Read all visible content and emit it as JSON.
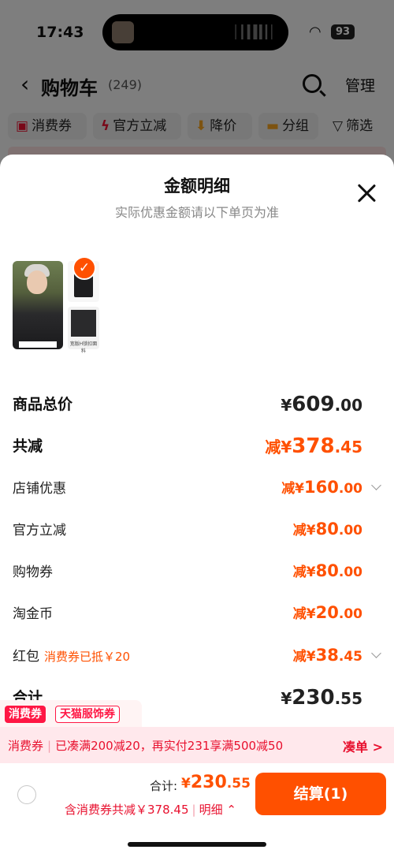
{
  "status": {
    "time": "17:43",
    "battery": "93"
  },
  "background": {
    "title": "购物车",
    "count": "(249)",
    "manage": "管理",
    "chips": [
      "消费券",
      "官方立减",
      "降价",
      "分组",
      "筛选"
    ]
  },
  "sheet": {
    "title": "金额明细",
    "subtitle": "实际优惠金额请以下单页为准",
    "product_caption": "宽版H锁扣面料"
  },
  "rows": [
    {
      "label": "商品总价",
      "prefix": "¥",
      "int": "609",
      "dec": ".00"
    },
    {
      "label": "共减",
      "prefix": "减¥",
      "int": "378",
      "dec": ".45"
    },
    {
      "label": "店铺优惠",
      "prefix": "减¥",
      "int": "160",
      "dec": ".00"
    },
    {
      "label": "官方立减",
      "prefix": "减¥",
      "int": "80",
      "dec": ".00"
    },
    {
      "label": "购物券",
      "prefix": "减¥",
      "int": "80",
      "dec": ".00"
    },
    {
      "label": "淘金币",
      "prefix": "减¥",
      "int": "20",
      "dec": ".00"
    },
    {
      "label": "红包",
      "note": "消费券已抵￥20",
      "prefix": "减¥",
      "int": "38",
      "dec": ".45"
    },
    {
      "label": "合计",
      "prefix": "¥",
      "int": "230",
      "dec": ".55"
    }
  ],
  "tags": {
    "t1": "消费券",
    "t2": "天猫服饰券"
  },
  "promo": {
    "name": "消费券",
    "text": "已凑满200减20，再实付231享满500减50",
    "action": "凑单 >"
  },
  "bottom": {
    "total_label": "合计:",
    "total_prefix": "¥",
    "total_int": "230",
    "total_dec": ".55",
    "discount": "含消费券共减￥378.45",
    "detail": "明细",
    "checkout": "结算(1)"
  },
  "colors": {
    "accent": "#ff5000",
    "promo_red": "#e8102e"
  }
}
